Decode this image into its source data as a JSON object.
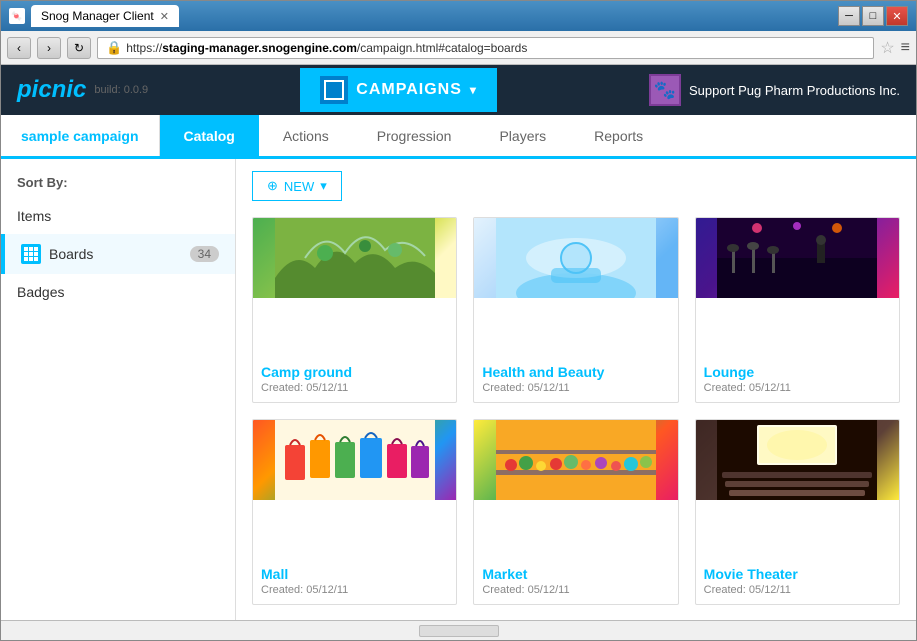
{
  "window": {
    "title": "Snog Manager Client",
    "close_btn": "✕",
    "min_btn": "─",
    "max_btn": "□"
  },
  "address": {
    "url_prefix": "https://",
    "url_highlight": "staging-manager.snogengine.com",
    "url_suffix": "/campaign.html#catalog=boards"
  },
  "header": {
    "logo": "picnic",
    "build": "build: 0.0.9",
    "campaigns_label": "CAMPAIGNS",
    "user_name": "Support Pug Pharm Productions Inc."
  },
  "tabs": {
    "campaign_name": "sample campaign",
    "items": [
      "Catalog",
      "Actions",
      "Progression",
      "Players",
      "Reports"
    ],
    "active": "Catalog"
  },
  "sidebar": {
    "sort_by": "Sort By:",
    "items": [
      {
        "label": "Items",
        "active": false,
        "badge": null
      },
      {
        "label": "Boards",
        "active": true,
        "badge": "34"
      },
      {
        "label": "Badges",
        "active": false,
        "badge": null
      }
    ]
  },
  "new_button": {
    "plus": "⊕",
    "label": "NEW",
    "arrow": "▾"
  },
  "boards": [
    {
      "title": "Camp ground",
      "created": "Created: 05/12/11",
      "style": "camp-ground-bg"
    },
    {
      "title": "Health and Beauty",
      "created": "Created: 05/12/11",
      "style": "health-beauty-bg"
    },
    {
      "title": "Lounge",
      "created": "Created: 05/12/11",
      "style": "lounge-bg"
    },
    {
      "title": "Mall",
      "created": "Created: 05/12/11",
      "style": "mall-bg"
    },
    {
      "title": "Market",
      "created": "Created: 05/12/11",
      "style": "market-bg"
    },
    {
      "title": "Movie Theater",
      "created": "Created: 05/12/11",
      "style": "theater-bg"
    }
  ]
}
